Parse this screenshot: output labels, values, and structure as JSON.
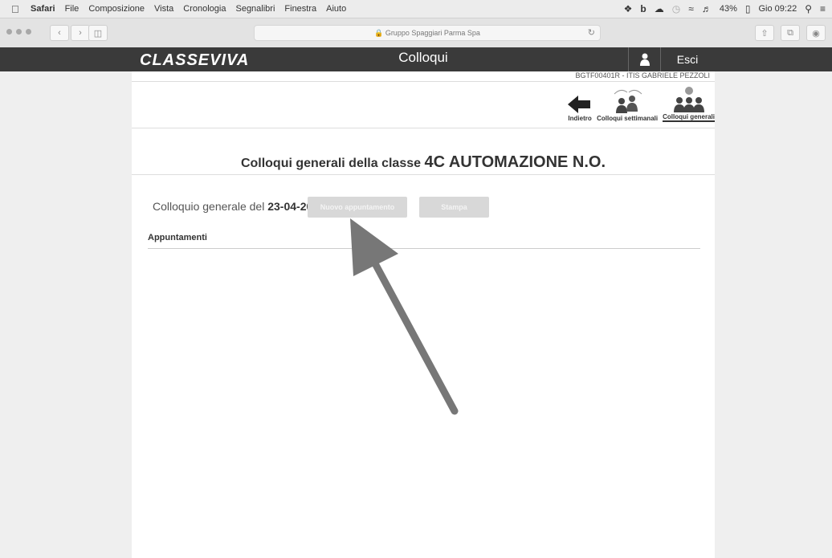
{
  "menubar": {
    "app": "Safari",
    "items": [
      "File",
      "Composizione",
      "Vista",
      "Cronologia",
      "Segnalibri",
      "Finestra",
      "Aiuto"
    ],
    "battery": "43%",
    "clock": "Gio 09:22"
  },
  "browser": {
    "url": "Gruppo Spaggiari Parma Spa"
  },
  "app": {
    "logo": "CLASSEVIVA",
    "title": "Colloqui",
    "logout": "Esci",
    "user_line": "BGTF00401R - ITIS   GABRIELE PEZZOLI"
  },
  "tools": {
    "back": "Indietro",
    "weekly": "Colloqui settimanali",
    "general": "Colloqui generali"
  },
  "main": {
    "heading_prefix": "Colloqui generali della classe",
    "class_name": "4C AUTOMAZIONE N.O.",
    "date_prefix": "Colloquio generale del",
    "date": "23-04-2015",
    "new_button": "Nuovo appuntamento",
    "print_button": "Stampa",
    "appointments_label": "Appuntamenti"
  },
  "colors": {
    "appbar": "#3a3a3a",
    "disabled_button": "#d8d8d8",
    "arrow": "#777777"
  }
}
